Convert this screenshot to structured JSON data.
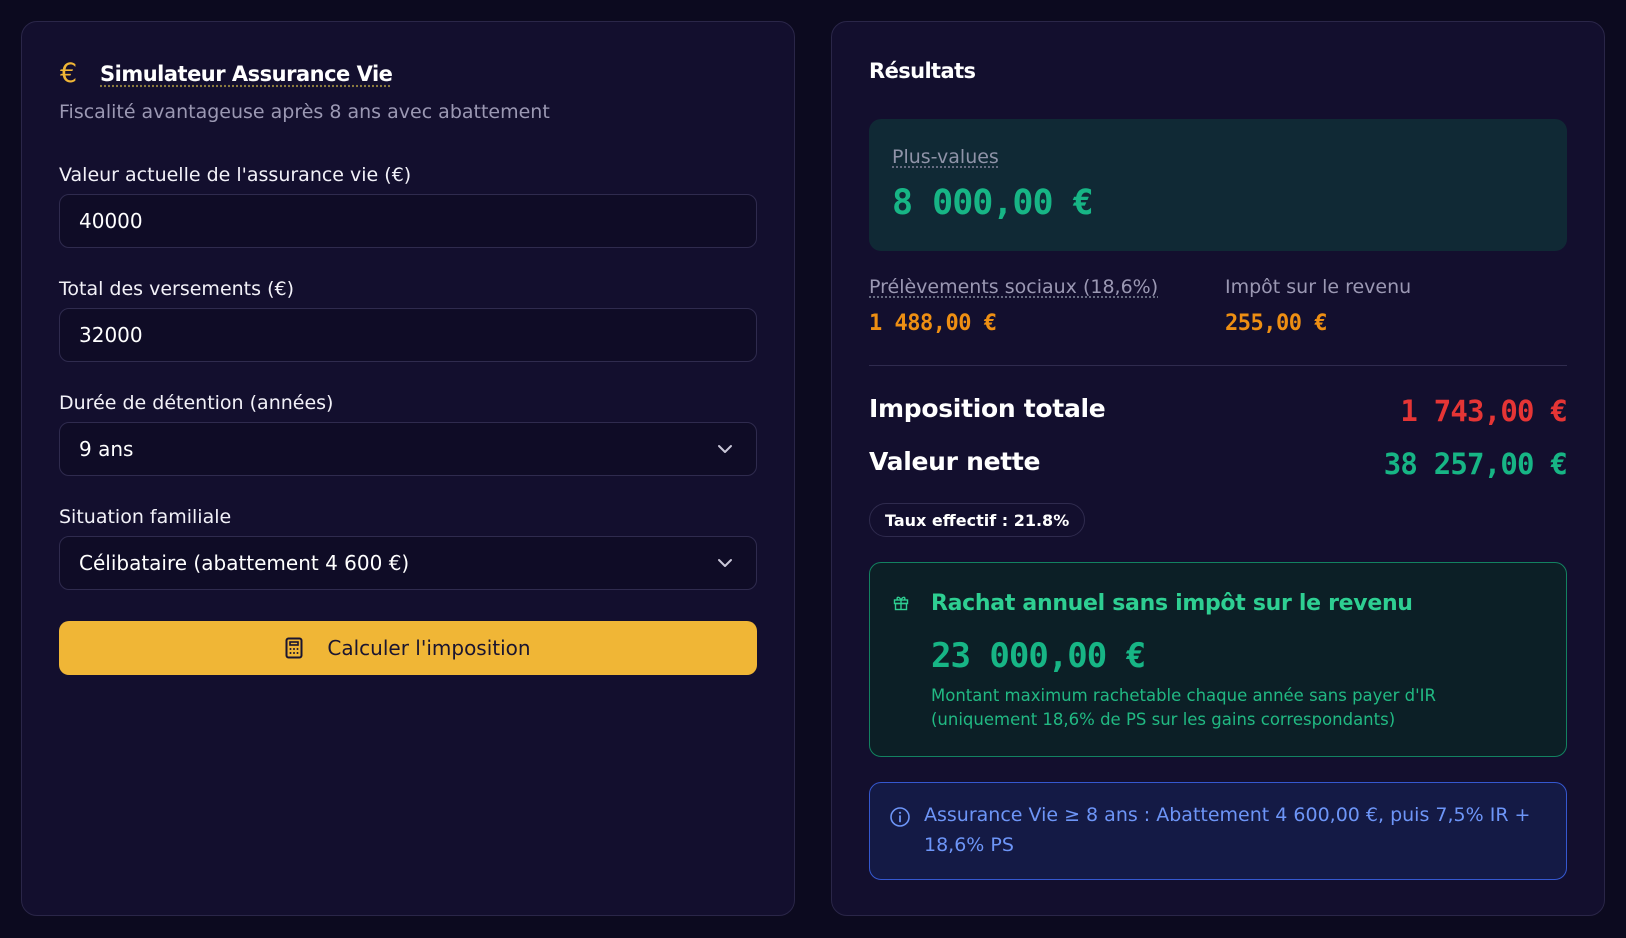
{
  "form": {
    "title": "Simulateur Assurance Vie",
    "subtitle": "Fiscalité avantageuse après 8 ans avec abattement",
    "valeur_label": "Valeur actuelle de l'assurance vie (€)",
    "valeur_value": "40000",
    "versements_label": "Total des versements (€)",
    "versements_value": "32000",
    "duree_label": "Durée de détention (années)",
    "duree_value": "9 ans",
    "situation_label": "Situation familiale",
    "situation_value": "Célibataire (abattement 4 600 €)",
    "calc_button_label": "Calculer l'imposition"
  },
  "results": {
    "title": "Résultats",
    "plus_values_label": "Plus-values",
    "plus_values_value": "8 000,00 €",
    "prelevements_label": "Prélèvements sociaux (18,6%)",
    "prelevements_value": "1 488,00 €",
    "impot_label": "Impôt sur le revenu",
    "impot_value": "255,00 €",
    "imposition_totale_label": "Imposition totale",
    "imposition_totale_value": "1 743,00 €",
    "valeur_nette_label": "Valeur nette",
    "valeur_nette_value": "38 257,00 €",
    "taux_effectif": "Taux effectif : 21.8%",
    "rachat_title": "Rachat annuel sans impôt sur le revenu",
    "rachat_value": "23 000,00 €",
    "rachat_desc_line1": "Montant maximum rachetable chaque année sans payer d'IR",
    "rachat_desc_line2": "(uniquement 18,6% de PS sur les gains correspondants)",
    "info_text": "Assurance Vie ≥ 8 ans : Abattement 4 600,00 €, puis 7,5% IR + 18,6% PS"
  },
  "colors": {
    "accent": "#f0b636",
    "positive": "#17b585",
    "warning": "#ee8f13",
    "negative": "#e53535",
    "info": "#6d95f7"
  },
  "icons": {
    "title_icon": "euro-icon",
    "dropdown_icon": "chevron-down-icon",
    "button_icon": "calculator-icon",
    "rachat_icon": "gift-icon",
    "info_icon": "info-icon"
  }
}
